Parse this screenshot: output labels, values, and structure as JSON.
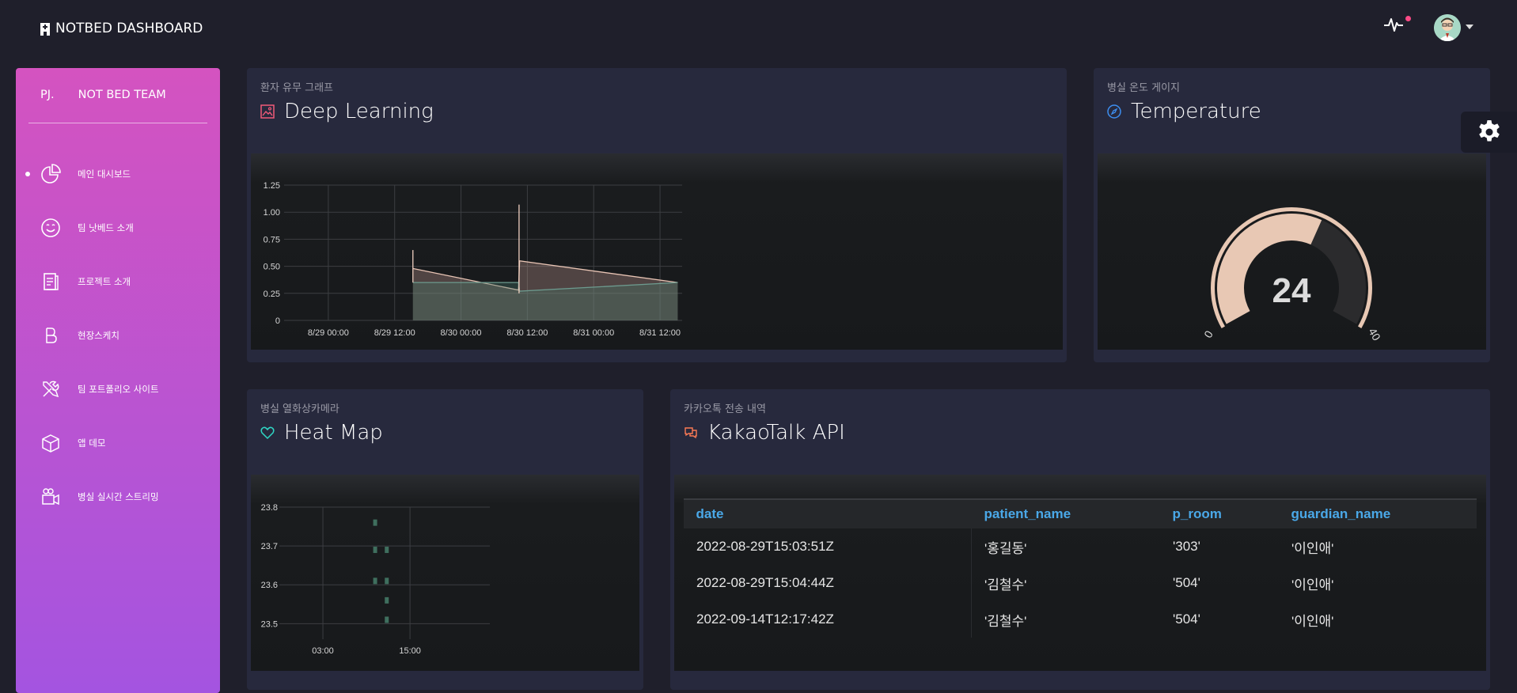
{
  "brand": {
    "title": "NOTBED DASHBOARD"
  },
  "sidebar": {
    "team_prefix": "PJ.",
    "team_name": "NOT BED TEAM",
    "items": [
      {
        "label": "메인 대시보드",
        "icon": "pie-chart-icon",
        "active": true
      },
      {
        "label": "팀 낫베드 소개",
        "icon": "smile-icon",
        "active": false
      },
      {
        "label": "프로젝트 소개",
        "icon": "document-icon",
        "active": false
      },
      {
        "label": "현장스케치",
        "icon": "bold-b-icon",
        "active": false
      },
      {
        "label": "팀 포트폴리오 사이트",
        "icon": "tools-icon",
        "active": false
      },
      {
        "label": "앱 데모",
        "icon": "box-icon",
        "active": false
      },
      {
        "label": "병실 실시간 스트리밍",
        "icon": "video-camera-icon",
        "active": false
      }
    ]
  },
  "cards": {
    "deep_learning": {
      "subtitle": "환자 유무 그래프",
      "title": "Deep Learning"
    },
    "temperature": {
      "subtitle": "병실 온도 게이지",
      "title": "Temperature"
    },
    "heat_map": {
      "subtitle": "병실 열화상카메라",
      "title": "Heat Map"
    },
    "kakaotalk": {
      "subtitle": "카카오톡 전송 내역",
      "title": "KakaoTalk API"
    }
  },
  "kakao_table": {
    "columns": [
      "date",
      "patient_name",
      "p_room",
      "guardian_name"
    ],
    "rows": [
      [
        "2022-08-29T15:03:51Z",
        "'홍길동'",
        "'303'",
        "'이인애'"
      ],
      [
        "2022-08-29T15:04:44Z",
        "'김철수'",
        "'504'",
        "'이인애'"
      ],
      [
        "2022-09-14T12:17:42Z",
        "'김철수'",
        "'504'",
        "'이인애'"
      ]
    ]
  },
  "chart_data": [
    {
      "type": "area",
      "x_ticks": [
        "8/29 00:00",
        "8/29 12:00",
        "8/30 00:00",
        "8/30 12:00",
        "8/31 00:00",
        "8/31 12:00"
      ],
      "y_ticks": [
        "0",
        "0.25",
        "0.50",
        "0.75",
        "1.00",
        "1.25"
      ],
      "ylim": [
        0,
        1.25
      ],
      "xlim_hours": [
        -8,
        64
      ],
      "series": [
        {
          "points": [
            [
              15.3,
              0.48
            ],
            [
              34.4,
              0.28
            ],
            [
              34.6,
              0.55
            ],
            [
              63.2,
              0.35
            ]
          ]
        },
        {
          "points": [
            [
              15.3,
              0.35
            ],
            [
              34.4,
              0.35
            ],
            [
              34.6,
              0.27
            ],
            [
              63.2,
              0.35
            ]
          ]
        }
      ],
      "spikes": [
        [
          15.3,
          0.35,
          0.65
        ],
        [
          34.5,
          0.25,
          1.07
        ]
      ],
      "grid": true
    },
    {
      "type": "gauge",
      "value": 24,
      "min": 0,
      "max": 40,
      "min_label": "0",
      "max_label": "40"
    },
    {
      "type": "scatter",
      "x_ticks": [
        "03:00",
        "15:00"
      ],
      "y_ticks": [
        "23.5",
        "23.6",
        "23.7",
        "23.8"
      ],
      "ylim": [
        23.46,
        23.8
      ],
      "points": [
        [
          10.2,
          23.76
        ],
        [
          10.2,
          23.69
        ],
        [
          10.2,
          23.61
        ],
        [
          11.8,
          23.69
        ],
        [
          11.8,
          23.61
        ],
        [
          11.8,
          23.56
        ],
        [
          11.8,
          23.51
        ]
      ],
      "grid": true
    }
  ]
}
